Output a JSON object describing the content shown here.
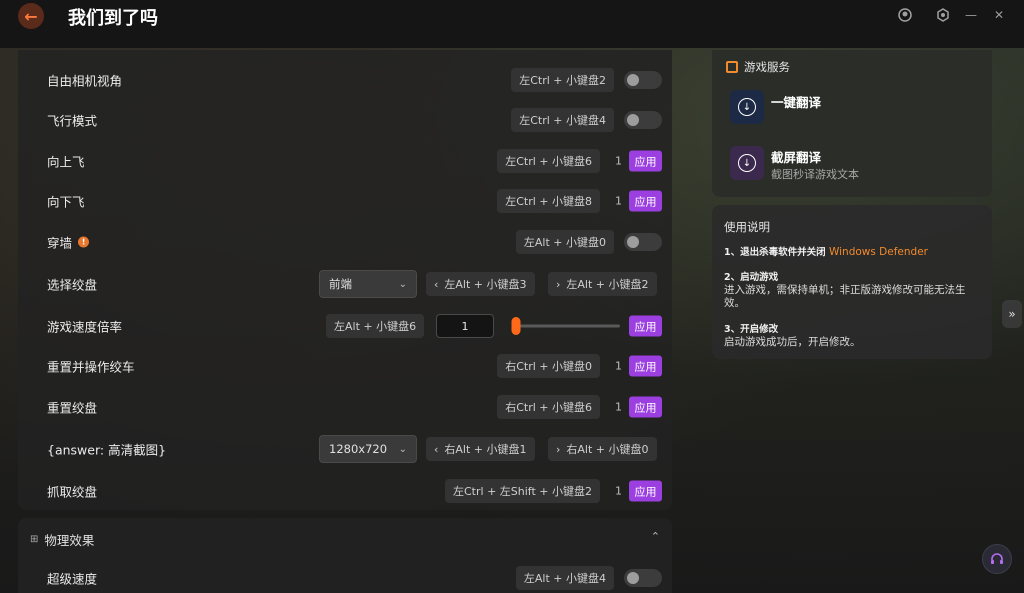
{
  "app": {
    "title": "我们到了吗",
    "back_icon": "arrow-left-icon"
  },
  "window_controls": [
    "avatar-icon",
    "settings-icon",
    "minimize-icon",
    "collapse-icon"
  ],
  "rows": [
    {
      "label": "自由相机视角",
      "key": "左Ctrl + 小键盘2",
      "control": "toggle",
      "on": false
    },
    {
      "label": "飞行模式",
      "key": "左Ctrl + 小键盘4",
      "control": "toggle",
      "on": false
    },
    {
      "label": "向上飞",
      "key": "左Ctrl + 小键盘6",
      "count": "1",
      "control": "apply"
    },
    {
      "label": "向下飞",
      "key": "左Ctrl + 小键盘8",
      "count": "1",
      "control": "apply"
    },
    {
      "label": "穿墙",
      "warn": "!",
      "key": "左Alt + 小键盘0",
      "control": "toggle",
      "on": false
    },
    {
      "label": "选择绞盘",
      "select": "前端",
      "prev": "左Alt + 小键盘3",
      "next": "左Alt + 小键盘2"
    },
    {
      "label": "游戏速度倍率",
      "key": "左Alt + 小键盘6",
      "value": "1",
      "slider_fraction": 0.0,
      "control": "apply"
    },
    {
      "label": "重置并操作绞车",
      "key": "右Ctrl + 小键盘0",
      "count": "1",
      "control": "apply"
    },
    {
      "label": "重置绞盘",
      "key": "右Ctrl + 小键盘6",
      "count": "1",
      "control": "apply"
    },
    {
      "label": "{answer: 高清截图}",
      "select": "1280x720",
      "prev": "右Alt + 小键盘1",
      "next": "右Alt + 小键盘0"
    },
    {
      "label": "抓取绞盘",
      "key": "左Ctrl + 左Shift + 小键盘2",
      "count": "1",
      "control": "apply"
    }
  ],
  "apply_label": "应用",
  "physics": {
    "title": "物理效果",
    "rows": [
      {
        "label": "超级速度",
        "key": "左Alt + 小键盘4",
        "on": false
      }
    ]
  },
  "services": {
    "title": "游戏服务",
    "items": [
      {
        "title": "一键翻译",
        "subtitle": ""
      },
      {
        "title": "截屏翻译",
        "subtitle": "截图秒译游戏文本"
      }
    ]
  },
  "help": {
    "title": "使用说明",
    "steps": [
      {
        "head": "1、退出杀毒软件并关闭",
        "link": "Windows Defender",
        "desc": ""
      },
      {
        "head": "2、启动游戏",
        "desc": "进入游戏，需保持单机；非正版游戏修改可能无法生效。"
      },
      {
        "head": "3、开启修改",
        "desc": "启动游戏成功后，开启修改。"
      }
    ]
  },
  "colors": {
    "accent_purple": "#9b3fe0",
    "accent_orange": "#f28a2e",
    "slider_thumb": "#ff6a1a"
  }
}
